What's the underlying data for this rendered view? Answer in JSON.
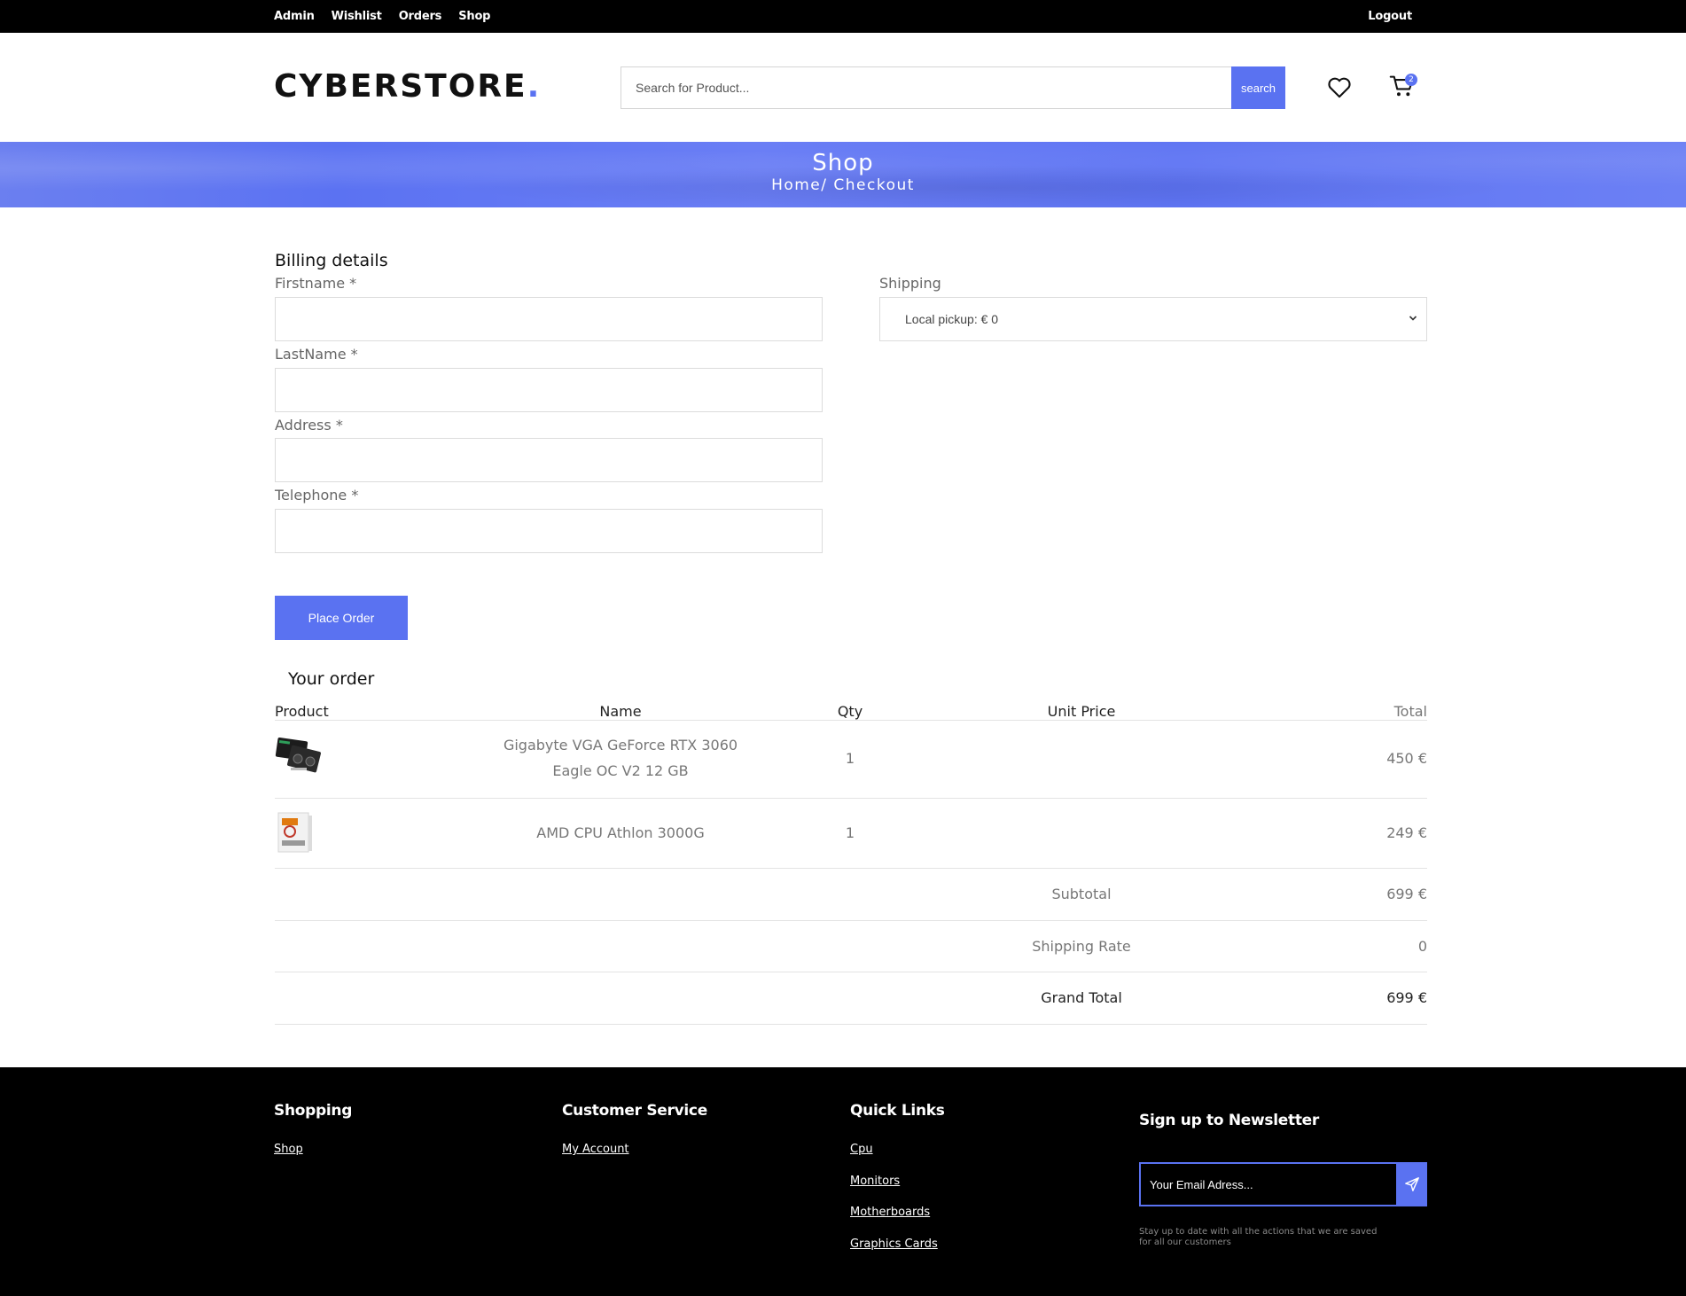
{
  "topbar": {
    "nav": [
      "Admin",
      "Wishlist",
      "Orders",
      "Shop"
    ],
    "logout": "Logout"
  },
  "header": {
    "logo": "CYBERSTORE",
    "logo_dot": ".",
    "search_placeholder": "Search for Product...",
    "search_button": "search",
    "cart_count": "2"
  },
  "banner": {
    "title": "Shop",
    "breadcrumb": "Home/ Checkout"
  },
  "billing": {
    "heading": "Billing details",
    "fields": [
      {
        "label": "Firstname",
        "required": "*"
      },
      {
        "label": "LastName",
        "required": "*"
      },
      {
        "label": "Address",
        "required": "*"
      },
      {
        "label": "Telephone",
        "required": "*"
      }
    ],
    "shipping_label": "Shipping",
    "shipping_selected": "Local pickup: € 0",
    "place_order": "Place Order"
  },
  "order": {
    "heading": "Your order",
    "columns": [
      "Product",
      "Name",
      "Qty",
      "Unit Price",
      "Total"
    ],
    "items": [
      {
        "name_line1": "Gigabyte VGA GeForce RTX 3060",
        "name_line2": "Eagle OC V2 12 GB",
        "qty": "1",
        "total": "450 €"
      },
      {
        "name_line1": "AMD CPU Athlon 3000G",
        "qty": "1",
        "total": "249 €"
      }
    ],
    "subtotal_label": "Subtotal",
    "subtotal": "699 €",
    "shipping_rate_label": "Shipping Rate",
    "shipping_rate": "0",
    "grand_total_label": "Grand Total",
    "grand_total": "699 €"
  },
  "footer": {
    "shopping": {
      "title": "Shopping",
      "links": [
        "Shop"
      ]
    },
    "customer_service": {
      "title": "Customer Service",
      "links": [
        "My Account"
      ]
    },
    "quick_links": {
      "title": "Quick Links",
      "links": [
        "Cpu",
        "Monitors",
        "Motherboards",
        "Graphics Cards"
      ]
    },
    "newsletter": {
      "title": "Sign up to Newsletter",
      "placeholder": "Your Email Adress...",
      "note": "Stay up to date with all the actions that we are saved for all our customers"
    }
  },
  "colors": {
    "accent": "#5a72f1",
    "topbar": "#000000",
    "footer": "#000000"
  }
}
